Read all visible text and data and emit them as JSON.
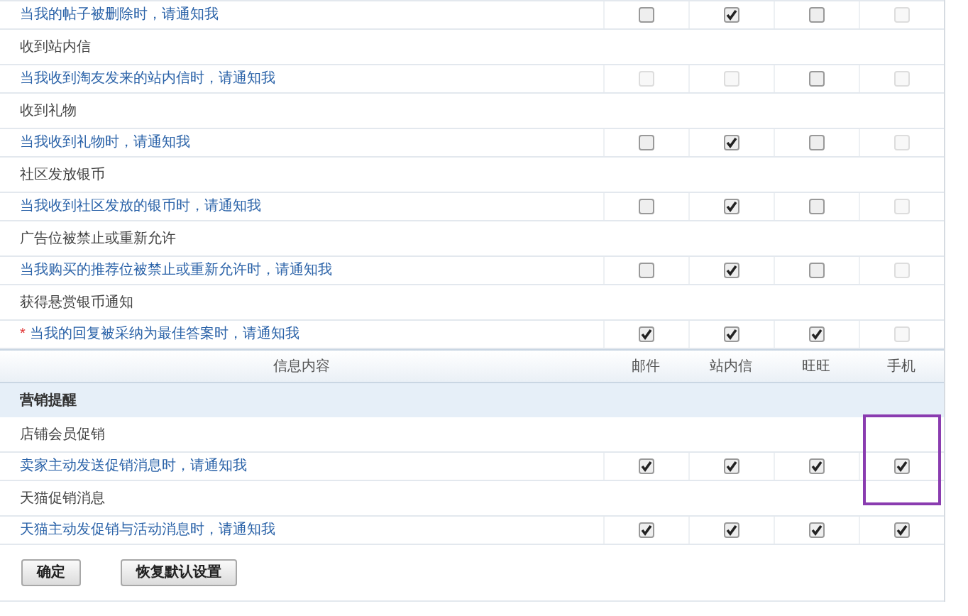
{
  "upper_rows": [
    {
      "kind": "option",
      "text": "当我的帖子被删除时，请通知我",
      "cells": [
        {
          "checked": false,
          "disabled": false
        },
        {
          "checked": true,
          "disabled": false
        },
        {
          "checked": false,
          "disabled": false
        },
        {
          "checked": false,
          "disabled": true
        }
      ]
    },
    {
      "kind": "group",
      "text": "收到站内信"
    },
    {
      "kind": "option",
      "text": "当我收到淘友发来的站内信时，请通知我",
      "cells": [
        {
          "checked": false,
          "disabled": true
        },
        {
          "checked": false,
          "disabled": true
        },
        {
          "checked": false,
          "disabled": false
        },
        {
          "checked": false,
          "disabled": true
        }
      ]
    },
    {
      "kind": "group",
      "text": "收到礼物"
    },
    {
      "kind": "option",
      "text": "当我收到礼物时，请通知我",
      "cells": [
        {
          "checked": false,
          "disabled": false
        },
        {
          "checked": true,
          "disabled": false
        },
        {
          "checked": false,
          "disabled": false
        },
        {
          "checked": false,
          "disabled": true
        }
      ]
    },
    {
      "kind": "group",
      "text": "社区发放银币"
    },
    {
      "kind": "option",
      "text": "当我收到社区发放的银币时，请通知我",
      "cells": [
        {
          "checked": false,
          "disabled": false
        },
        {
          "checked": true,
          "disabled": false
        },
        {
          "checked": false,
          "disabled": false
        },
        {
          "checked": false,
          "disabled": true
        }
      ]
    },
    {
      "kind": "group",
      "text": "广告位被禁止或重新允许"
    },
    {
      "kind": "option",
      "text": "当我购买的推荐位被禁止或重新允许时，请通知我",
      "cells": [
        {
          "checked": false,
          "disabled": false
        },
        {
          "checked": true,
          "disabled": false
        },
        {
          "checked": false,
          "disabled": false
        },
        {
          "checked": false,
          "disabled": true
        }
      ]
    },
    {
      "kind": "group",
      "text": "获得悬赏银币通知"
    },
    {
      "kind": "option",
      "marker": "*",
      "text": "当我的回复被采纳为最佳答案时，请通知我",
      "cells": [
        {
          "checked": true,
          "disabled": false
        },
        {
          "checked": true,
          "disabled": false
        },
        {
          "checked": true,
          "disabled": false
        },
        {
          "checked": false,
          "disabled": true
        }
      ]
    }
  ],
  "header": {
    "content": "信息内容",
    "columns": [
      "邮件",
      "站内信",
      "旺旺",
      "手机"
    ]
  },
  "section": {
    "title": "营销提醒",
    "rows": [
      {
        "kind": "group",
        "text": "店铺会员促销"
      },
      {
        "kind": "option",
        "text": "卖家主动发送促销消息时，请通知我",
        "highlight_last": true,
        "cells": [
          {
            "checked": true,
            "disabled": false
          },
          {
            "checked": true,
            "disabled": false
          },
          {
            "checked": true,
            "disabled": false
          },
          {
            "checked": true,
            "disabled": false
          }
        ]
      },
      {
        "kind": "group",
        "text": "天猫促销消息"
      },
      {
        "kind": "option",
        "text": "天猫主动发促销与活动消息时，请通知我",
        "cells": [
          {
            "checked": true,
            "disabled": false
          },
          {
            "checked": true,
            "disabled": false
          },
          {
            "checked": true,
            "disabled": false
          },
          {
            "checked": true,
            "disabled": false
          }
        ]
      }
    ]
  },
  "buttons": [
    "确定",
    "恢复默认设置"
  ]
}
